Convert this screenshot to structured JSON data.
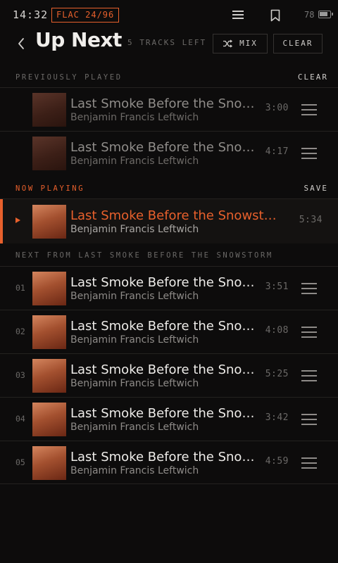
{
  "status": {
    "time": "14:32",
    "format": "FLAC 24/96",
    "battery": "78"
  },
  "header": {
    "title": "Up Next",
    "tracks_left": "5 TRACKS LEFT",
    "mix_label": "MIX",
    "clear_label": "CLEAR"
  },
  "previously_played": {
    "label": "PREVIOUSLY PLAYED",
    "action": "CLEAR",
    "items": [
      {
        "title": "Last Smoke Before the Snowstorm",
        "artist": "Benjamin Francis Leftwich",
        "duration": "3:00"
      },
      {
        "title": "Last Smoke Before the Snowstorm",
        "artist": "Benjamin Francis Leftwich",
        "duration": "4:17"
      }
    ]
  },
  "now_playing": {
    "label": "NOW PLAYING",
    "action": "SAVE",
    "item": {
      "title": "Last Smoke Before the Snowstorm",
      "artist": "Benjamin Francis Leftwich",
      "duration": "5:34"
    }
  },
  "next_from": {
    "label": "NEXT FROM LAST SMOKE BEFORE THE SNOWSTORM",
    "items": [
      {
        "num": "01",
        "title": "Last Smoke Before the Snowstorm",
        "artist": "Benjamin Francis Leftwich",
        "duration": "3:51"
      },
      {
        "num": "02",
        "title": "Last Smoke Before the Snowstorm",
        "artist": "Benjamin Francis Leftwich",
        "duration": "4:08"
      },
      {
        "num": "03",
        "title": "Last Smoke Before the Snowstorm",
        "artist": "Benjamin Francis Leftwich",
        "duration": "5:25"
      },
      {
        "num": "04",
        "title": "Last Smoke Before the Snowstorm",
        "artist": "Benjamin Francis Leftwich",
        "duration": "3:42"
      },
      {
        "num": "05",
        "title": "Last Smoke Before the Snowstorm",
        "artist": "Benjamin Francis Leftwich",
        "duration": "4:59"
      }
    ]
  },
  "colors": {
    "accent": "#e8602c",
    "background": "#0d0c0c"
  },
  "icons": [
    "menu-icon",
    "bookmark-icon",
    "battery-icon",
    "back-chevron-icon",
    "shuffle-icon",
    "play-indicator-icon",
    "drag-handle-icon"
  ]
}
